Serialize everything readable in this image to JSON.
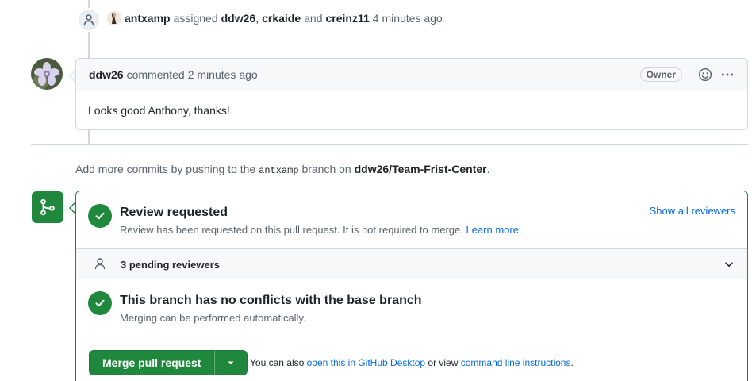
{
  "assign_event": {
    "actor": "antxamp",
    "verb": "assigned",
    "assignee1": "ddw26",
    "sep": ",",
    "assignee2": "crkaide",
    "and": "and",
    "assignee3": "creinz11",
    "time": "4 minutes ago"
  },
  "comment": {
    "author": "ddw26",
    "action": "commented",
    "time": "2 minutes ago",
    "badge": "Owner",
    "body": "Looks good Anthony, thanks!"
  },
  "push_note": {
    "prefix": "Add more commits by pushing to the",
    "branch": "antxamp",
    "middle": "branch on",
    "repo": "ddw26/Team-Frist-Center",
    "suffix": "."
  },
  "merge_box": {
    "review": {
      "title": "Review requested",
      "subtitle": "Review has been requested on this pull request. It is not required to merge.",
      "learn_more": "Learn more.",
      "show_all": "Show all reviewers"
    },
    "pending": {
      "label": "3 pending reviewers"
    },
    "conflicts": {
      "title": "This branch has no conflicts with the base branch",
      "subtitle": "Merging can be performed automatically."
    },
    "merge_button": "Merge pull request",
    "also": {
      "prefix": "You can also",
      "desktop_link": "open this in GitHub Desktop",
      "middle": "or view",
      "cli_link": "command line instructions",
      "suffix": "."
    }
  },
  "colors": {
    "green": "#1f883d",
    "link": "#0969da",
    "border": "#d0d7de",
    "muted": "#59636e"
  },
  "icons": [
    "person-icon",
    "smiley-icon",
    "kebab-icon",
    "git-merge-icon",
    "check-icon",
    "chevron-down-icon",
    "triangle-down-icon"
  ]
}
